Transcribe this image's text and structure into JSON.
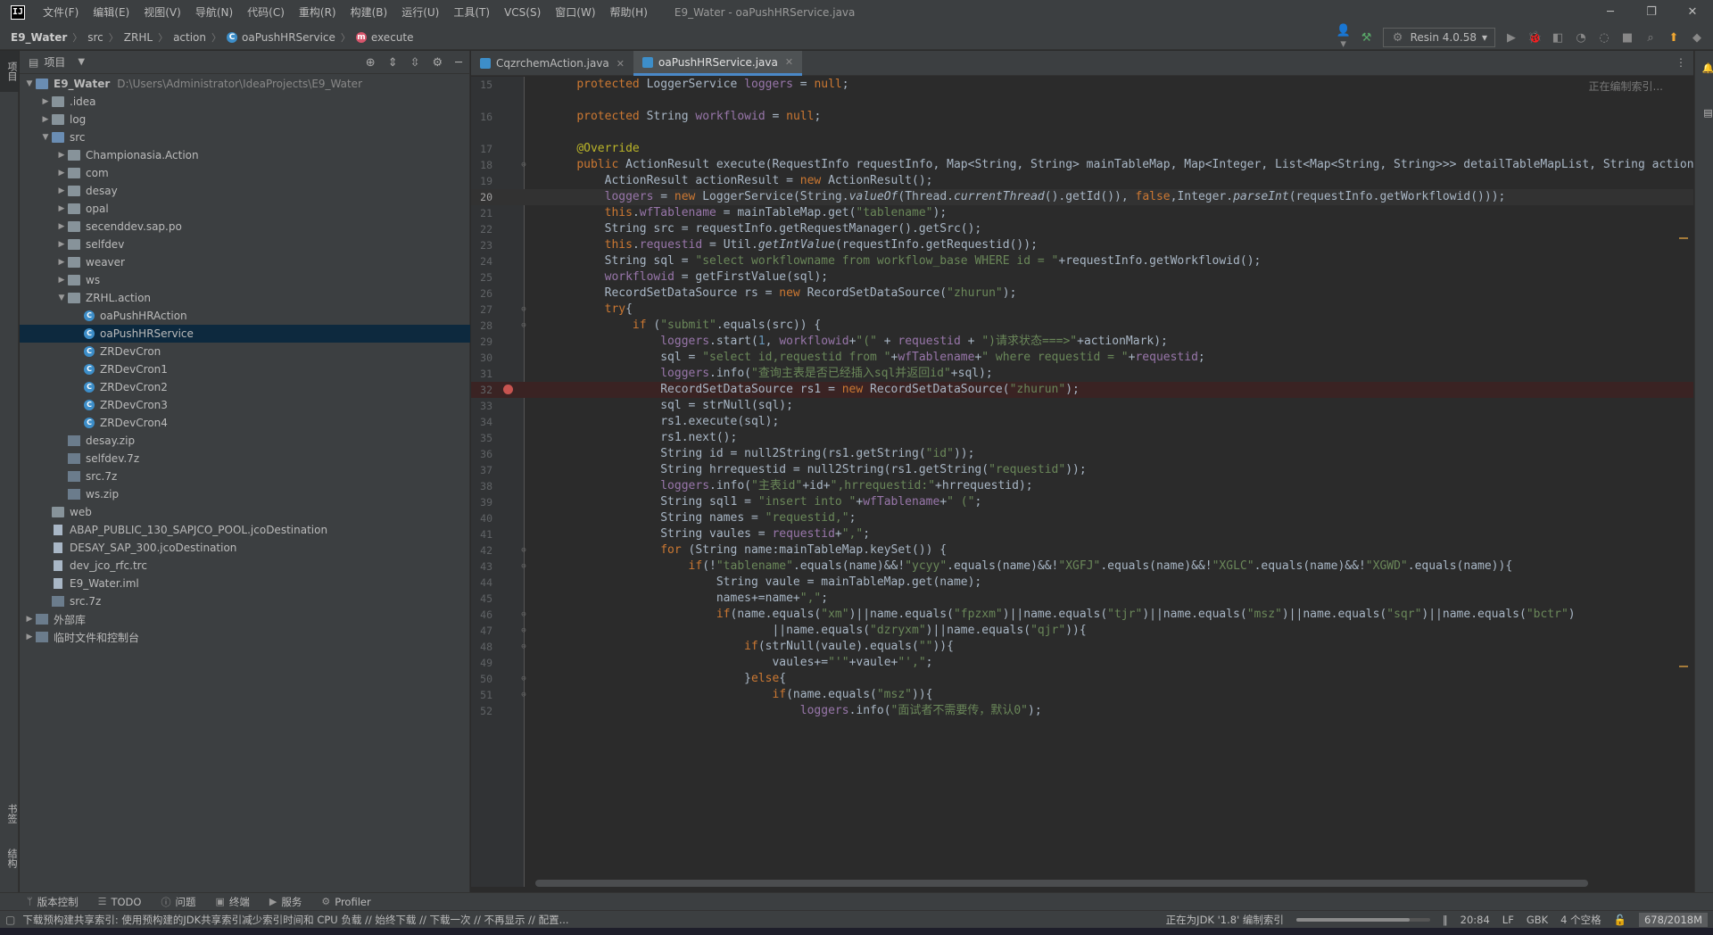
{
  "titlebar": {
    "menus": [
      "文件(F)",
      "编辑(E)",
      "视图(V)",
      "导航(N)",
      "代码(C)",
      "重构(R)",
      "构建(B)",
      "运行(U)",
      "工具(T)",
      "VCS(S)",
      "窗口(W)",
      "帮助(H)"
    ],
    "title": "E9_Water - oaPushHRService.java",
    "logo": "IJ"
  },
  "navbar": {
    "crumbs": [
      "E9_Water",
      "src",
      "ZRHL",
      "action",
      "oaPushHRService",
      "execute"
    ],
    "run_config": "Resin 4.0.58"
  },
  "project_panel": {
    "title": "项目",
    "tree": [
      {
        "label": "E9_Water",
        "path": "D:\\Users\\Administrator\\IdeaProjects\\E9_Water",
        "depth": 0,
        "icon": "folder-blue",
        "arrow": "open",
        "bold": true
      },
      {
        "label": ".idea",
        "depth": 1,
        "icon": "folder",
        "arrow": "closed"
      },
      {
        "label": "log",
        "depth": 1,
        "icon": "folder",
        "arrow": "closed"
      },
      {
        "label": "src",
        "depth": 1,
        "icon": "folder-blue",
        "arrow": "open"
      },
      {
        "label": "Championasia.Action",
        "depth": 2,
        "icon": "folder",
        "arrow": "closed"
      },
      {
        "label": "com",
        "depth": 2,
        "icon": "folder",
        "arrow": "closed"
      },
      {
        "label": "desay",
        "depth": 2,
        "icon": "folder",
        "arrow": "closed"
      },
      {
        "label": "opal",
        "depth": 2,
        "icon": "folder",
        "arrow": "closed"
      },
      {
        "label": "secenddev.sap.po",
        "depth": 2,
        "icon": "folder",
        "arrow": "closed"
      },
      {
        "label": "selfdev",
        "depth": 2,
        "icon": "folder",
        "arrow": "closed"
      },
      {
        "label": "weaver",
        "depth": 2,
        "icon": "folder",
        "arrow": "closed"
      },
      {
        "label": "ws",
        "depth": 2,
        "icon": "folder",
        "arrow": "closed"
      },
      {
        "label": "ZRHL.action",
        "depth": 2,
        "icon": "folder",
        "arrow": "open"
      },
      {
        "label": "oaPushHRAction",
        "depth": 3,
        "icon": "class",
        "arrow": "none"
      },
      {
        "label": "oaPushHRService",
        "depth": 3,
        "icon": "class",
        "arrow": "none",
        "selected": true
      },
      {
        "label": "ZRDevCron",
        "depth": 3,
        "icon": "class",
        "arrow": "none"
      },
      {
        "label": "ZRDevCron1",
        "depth": 3,
        "icon": "class",
        "arrow": "none"
      },
      {
        "label": "ZRDevCron2",
        "depth": 3,
        "icon": "class",
        "arrow": "none"
      },
      {
        "label": "ZRDevCron3",
        "depth": 3,
        "icon": "class",
        "arrow": "none"
      },
      {
        "label": "ZRDevCron4",
        "depth": 3,
        "icon": "class",
        "arrow": "none"
      },
      {
        "label": "desay.zip",
        "depth": 2,
        "icon": "lib",
        "arrow": "none"
      },
      {
        "label": "selfdev.7z",
        "depth": 2,
        "icon": "lib",
        "arrow": "none"
      },
      {
        "label": "src.7z",
        "depth": 2,
        "icon": "lib",
        "arrow": "none"
      },
      {
        "label": "ws.zip",
        "depth": 2,
        "icon": "lib",
        "arrow": "none"
      },
      {
        "label": "web",
        "depth": 1,
        "icon": "folder",
        "arrow": "none"
      },
      {
        "label": "ABAP_PUBLIC_130_SAPJCO_POOL.jcoDestination",
        "depth": 1,
        "icon": "file",
        "arrow": "none"
      },
      {
        "label": "DESAY_SAP_300.jcoDestination",
        "depth": 1,
        "icon": "file",
        "arrow": "none"
      },
      {
        "label": "dev_jco_rfc.trc",
        "depth": 1,
        "icon": "file",
        "arrow": "none"
      },
      {
        "label": "E9_Water.iml",
        "depth": 1,
        "icon": "file",
        "arrow": "none"
      },
      {
        "label": "src.7z",
        "depth": 1,
        "icon": "lib",
        "arrow": "none"
      },
      {
        "label": "外部库",
        "depth": 0,
        "icon": "lib",
        "arrow": "closed"
      },
      {
        "label": "临时文件和控制台",
        "depth": 0,
        "icon": "lib",
        "arrow": "closed"
      }
    ]
  },
  "left_stripe": {
    "project": "项目",
    "bookmarks": "书签",
    "structure": "结构"
  },
  "editor": {
    "tabs": [
      {
        "label": "CqzrchemAction.java",
        "active": false
      },
      {
        "label": "oaPushHRService.java",
        "active": true
      }
    ],
    "indexing_notice": "正在编制索引...",
    "current_line": 20,
    "breakpoint_line": 32,
    "lines": [
      {
        "n": 15,
        "html": "    <span class=\"k\">protected</span> LoggerService <span class=\"f\">loggers</span> = <span class=\"k\">null</span>;"
      },
      {
        "n": 16,
        "html": "    <span class=\"k\">protected</span> String <span class=\"f\">workflowid</span> = <span class=\"k\">null</span>;"
      },
      {
        "n": 17,
        "html": "    <span class=\"a\">@Override</span>"
      },
      {
        "n": 18,
        "html": "    <span class=\"k\">public</span> ActionResult execute(RequestInfo requestInfo, Map&lt;String, String&gt; mainTableMap, Map&lt;Integer, List&lt;Map&lt;String, String&gt;&gt;&gt; detailTableMapList, String actionMark) {"
      },
      {
        "n": 19,
        "html": "        ActionResult actionResult = <span class=\"k\">new</span> ActionResult();"
      },
      {
        "n": 20,
        "html": "        <span class=\"f\">loggers</span> = <span class=\"k\">new</span> LoggerService(String.<i>valueOf</i>(Thread.<i>currentThread</i>().getId()), <span class=\"k\">false</span>,Integer.<i>parseInt</i>(requestInfo.getWorkflowid()));"
      },
      {
        "n": 21,
        "html": "        <span class=\"k\">this</span>.<span class=\"f\">wfTablename</span> = mainTableMap.get(<span class=\"s\">\"tablename\"</span>);"
      },
      {
        "n": 22,
        "html": "        String src = requestInfo.getRequestManager().getSrc();"
      },
      {
        "n": 23,
        "html": "        <span class=\"k\">this</span>.<span class=\"f\">requestid</span> = Util.<i>getIntValue</i>(requestInfo.getRequestid());"
      },
      {
        "n": 24,
        "html": "        String sql = <span class=\"s\">\"select workflowname from workflow_base WHERE id = \"</span>+requestInfo.getWorkflowid();"
      },
      {
        "n": 25,
        "html": "        <span class=\"f\">workflowid</span> = getFirstValue(sql);"
      },
      {
        "n": 26,
        "html": "        RecordSetDataSource rs = <span class=\"k\">new</span> RecordSetDataSource(<span class=\"s\">\"zhurun\"</span>);"
      },
      {
        "n": 27,
        "html": "        <span class=\"k\">try</span>{"
      },
      {
        "n": 28,
        "html": "            <span class=\"k\">if</span> (<span class=\"s\">\"submit\"</span>.equals(src)) {"
      },
      {
        "n": 29,
        "html": "                <span class=\"f\">loggers</span>.start(<span class=\"n\">1</span>, <span class=\"f\">workflowid</span>+<span class=\"s\">\"(\"</span> + <span class=\"f\">requestid</span> + <span class=\"s\">\")请求状态===>\"</span>+actionMark);"
      },
      {
        "n": 30,
        "html": "                sql = <span class=\"s\">\"select id,requestid from \"</span>+<span class=\"f\">wfTablename</span>+<span class=\"s\">\" where requestid = \"</span>+<span class=\"f\">requestid</span>;"
      },
      {
        "n": 31,
        "html": "                <span class=\"f\">loggers</span>.info(<span class=\"s\">\"查询主表是否已经插入sql并返回id\"</span>+sql);"
      },
      {
        "n": 32,
        "html": "                RecordSetDataSource rs1 = <span class=\"k\">new</span> RecordSetDataSource(<span class=\"s\">\"zhurun\"</span>);"
      },
      {
        "n": 33,
        "html": "                sql = strNull(sql);"
      },
      {
        "n": 34,
        "html": "                rs1.execute(sql);"
      },
      {
        "n": 35,
        "html": "                rs1.next();"
      },
      {
        "n": 36,
        "html": "                String id = null2String(rs1.getString(<span class=\"s\">\"id\"</span>));"
      },
      {
        "n": 37,
        "html": "                String hrrequestid = null2String(rs1.getString(<span class=\"s\">\"requestid\"</span>));"
      },
      {
        "n": 38,
        "html": "                <span class=\"f\">loggers</span>.info(<span class=\"s\">\"主表id\"</span>+id+<span class=\"s\">\",hrrequestid:\"</span>+hrrequestid);"
      },
      {
        "n": 39,
        "html": "                String sql1 = <span class=\"s\">\"insert into \"</span>+<span class=\"f\">wfTablename</span>+<span class=\"s\">\" (\"</span>;"
      },
      {
        "n": 40,
        "html": "                String names = <span class=\"s\">\"requestid,\"</span>;"
      },
      {
        "n": 41,
        "html": "                String vaules = <span class=\"f\">requestid</span>+<span class=\"s\">\",\"</span>;"
      },
      {
        "n": 42,
        "html": "                <span class=\"k\">for</span> (String name:mainTableMap.keySet()) {"
      },
      {
        "n": 43,
        "html": "                    <span class=\"k\">if</span>(!<span class=\"s\">\"tablename\"</span>.equals(name)&amp;&amp;!<span class=\"s\">\"ycyy\"</span>.equals(name)&amp;&amp;!<span class=\"s\">\"XGFJ\"</span>.equals(name)&amp;&amp;!<span class=\"s\">\"XGLC\"</span>.equals(name)&amp;&amp;!<span class=\"s\">\"XGWD\"</span>.equals(name)){"
      },
      {
        "n": 44,
        "html": "                        String vaule = mainTableMap.get(name);"
      },
      {
        "n": 45,
        "html": "                        names+=name+<span class=\"s\">\",\"</span>;"
      },
      {
        "n": 46,
        "html": "                        <span class=\"k\">if</span>(name.equals(<span class=\"s\">\"xm\"</span>)||name.equals(<span class=\"s\">\"fpzxm\"</span>)||name.equals(<span class=\"s\">\"tjr\"</span>)||name.equals(<span class=\"s\">\"msz\"</span>)||name.equals(<span class=\"s\">\"sqr\"</span>)||name.equals(<span class=\"s\">\"bctr\"</span>)"
      },
      {
        "n": 47,
        "html": "                                ||name.equals(<span class=\"s\">\"dzryxm\"</span>)||name.equals(<span class=\"s\">\"qjr\"</span>)){"
      },
      {
        "n": 48,
        "html": "                            <span class=\"k\">if</span>(strNull(vaule).equals(<span class=\"s\">\"\"</span>)){"
      },
      {
        "n": 49,
        "html": "                                vaules+=<span class=\"s\">\"'\"</span>+vaule+<span class=\"s\">\"',\"</span>;"
      },
      {
        "n": 50,
        "html": "                            }<span class=\"k\">else</span>{"
      },
      {
        "n": 51,
        "html": "                                <span class=\"k\">if</span>(name.equals(<span class=\"s\">\"msz\"</span>)){"
      },
      {
        "n": 52,
        "html": "                                    <span class=\"f\">loggers</span>.info(<span class=\"s\">\"面试者不需要传，默认0\"</span>);"
      }
    ],
    "fold_lines": [
      18,
      27,
      28,
      42,
      43,
      46,
      47,
      48,
      50,
      51
    ]
  },
  "tool_windows": [
    {
      "label": "版本控制",
      "icon": "branch-icon",
      "glyph": "ᛘ"
    },
    {
      "label": "TODO",
      "icon": "list-icon",
      "glyph": "☰"
    },
    {
      "label": "问题",
      "icon": "info-icon",
      "glyph": "ⓘ"
    },
    {
      "label": "终端",
      "icon": "terminal-icon",
      "glyph": "▣"
    },
    {
      "label": "服务",
      "icon": "play-icon",
      "glyph": "▶"
    },
    {
      "label": "Profiler",
      "icon": "profiler-icon",
      "glyph": "⚙"
    }
  ],
  "statusbar": {
    "message": "下载预构建共享索引: 使用预构建的JDK共享索引减少索引时间和 CPU 负载 // 始终下载 // 下载一次 // 不再显示 // 配置...",
    "indexing": "正在为JDK '1.8' 编制索引",
    "progress": 0.85,
    "position": "20:84",
    "line_sep": "LF",
    "encoding": "GBK",
    "indent": "4 个空格",
    "memory": "678/2018M"
  }
}
